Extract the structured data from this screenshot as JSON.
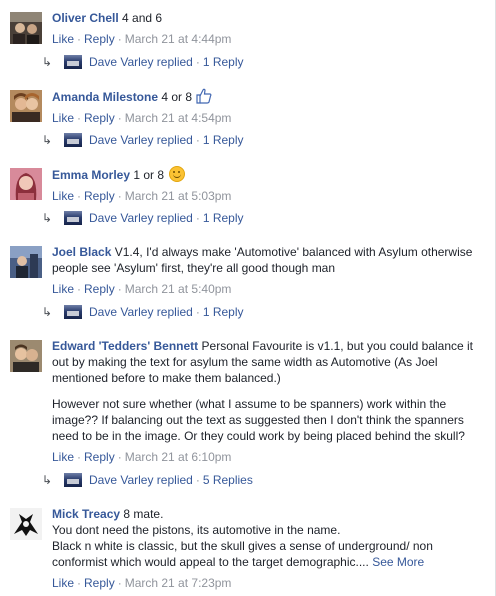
{
  "comments": [
    {
      "author": "Oliver Chell",
      "text": "4 and 6",
      "actions": {
        "like": "Like",
        "reply": "Reply",
        "time": "March 21 at 4:44pm"
      },
      "replies": {
        "name": "Dave Varley replied",
        "count": "1 Reply"
      }
    },
    {
      "author": "Amanda Milestone",
      "text": "4 or 8",
      "icon": "thumbs-up-icon",
      "actions": {
        "like": "Like",
        "reply": "Reply",
        "time": "March 21 at 4:54pm"
      },
      "replies": {
        "name": "Dave Varley replied",
        "count": "1 Reply"
      }
    },
    {
      "author": "Emma Morley",
      "text": "1 or 8",
      "icon": "smiley-emoji-icon",
      "actions": {
        "like": "Like",
        "reply": "Reply",
        "time": "March 21 at 5:03pm"
      },
      "replies": {
        "name": "Dave Varley replied",
        "count": "1 Reply"
      }
    },
    {
      "author": "Joel Black",
      "text": "V1.4, I'd always make 'Automotive' balanced with Asylum otherwise people see 'Asylum' first, they're all good though man",
      "actions": {
        "like": "Like",
        "reply": "Reply",
        "time": "March 21 at 5:40pm"
      },
      "replies": {
        "name": "Dave Varley replied",
        "count": "1 Reply"
      }
    },
    {
      "author": "Edward 'Tedders' Bennett",
      "text": "Personal Favourite is v1.1, but you could balance it out by making the text for asylum the same width as Automotive (As Joel mentioned before to make them balanced.)",
      "text2": "However not sure whether (what I assume to be spanners) work within the image?? If balancing out the text as suggested then I don't think the spanners need to be in the image. Or they could work by being placed behind the skull?",
      "actions": {
        "like": "Like",
        "reply": "Reply",
        "time": "March 21 at 6:10pm"
      },
      "replies": {
        "name": "Dave Varley replied",
        "count": "5 Replies"
      }
    },
    {
      "author": "Mick Treacy",
      "text": "8 mate.",
      "text2": "You dont need the pistons, its automotive in the name.",
      "text3": "Black n white is classic, but the skull gives a sense of underground/ non conformist which would appeal to the target demographic....",
      "see_more": "See More",
      "actions": {
        "like": "Like",
        "reply": "Reply",
        "time": "March 21 at 7:23pm"
      }
    }
  ],
  "separator": "·"
}
